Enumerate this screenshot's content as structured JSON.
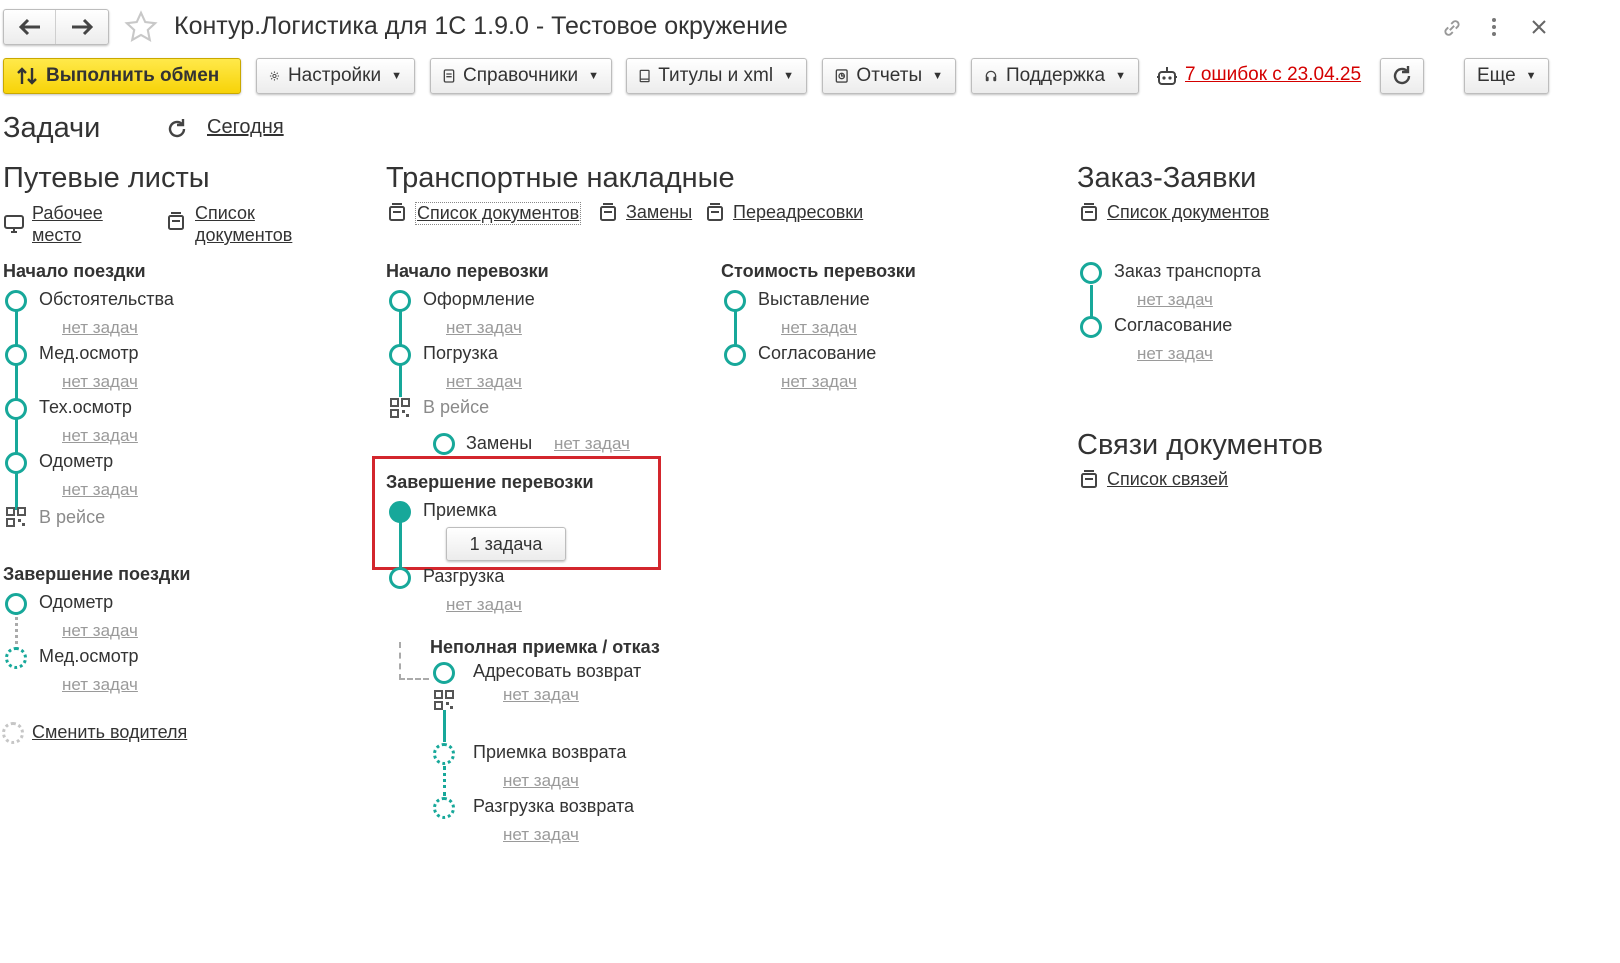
{
  "window": {
    "title": "Контур.Логистика для 1С 1.9.0 - Тестовое окружение"
  },
  "toolbar": {
    "exchange": "Выполнить обмен",
    "settings": "Настройки",
    "references": "Справочники",
    "titles": "Титулы и xml",
    "reports": "Отчеты",
    "support": "Поддержка",
    "errors": "7 ошибок с 23.04.25",
    "more": "Еще"
  },
  "tasks": {
    "title": "Задачи",
    "today": "Сегодня"
  },
  "waybills": {
    "title": "Путевые листы",
    "workplace": "Рабочее место",
    "doc_list": "Список документов",
    "start_group": "Начало поездки",
    "start_items": [
      "Обстоятельства",
      "Мед.осмотр",
      "Тех.осмотр",
      "Одометр"
    ],
    "in_trip": "В рейсе",
    "end_group": "Завершение поездки",
    "end_items": [
      "Одометр",
      "Мед.осмотр"
    ],
    "change_driver": "Сменить водителя"
  },
  "transport": {
    "title": "Транспортные накладные",
    "doc_list": "Список документов",
    "replacements": "Замены",
    "readdress": "Переадресовки",
    "start_group": "Начало перевозки",
    "start_items": [
      "Оформление",
      "Погрузка"
    ],
    "in_trip": "В рейсе",
    "replacements_item": "Замены",
    "end_group": "Завершение перевозки",
    "acceptance": "Приемка",
    "task_button": "1 задача",
    "unloading": "Разгрузка",
    "partial_group": "Неполная приемка / отказ",
    "partial_items": [
      "Адресовать возврат",
      "Приемка возврата",
      "Разгрузка возврата"
    ]
  },
  "cost": {
    "group": "Стоимость перевозки",
    "items": [
      "Выставление",
      "Согласование"
    ]
  },
  "orders": {
    "title": "Заказ-Заявки",
    "doc_list": "Список документов",
    "items": [
      "Заказ транспорта",
      "Согласование"
    ]
  },
  "links": {
    "title": "Связи документов",
    "list": "Список связей"
  },
  "common": {
    "no_tasks": "нет задач"
  },
  "colors": {
    "accent": "#17a89a",
    "primary": "#f7d308",
    "error": "#d40000",
    "highlight": "#d3262d"
  }
}
